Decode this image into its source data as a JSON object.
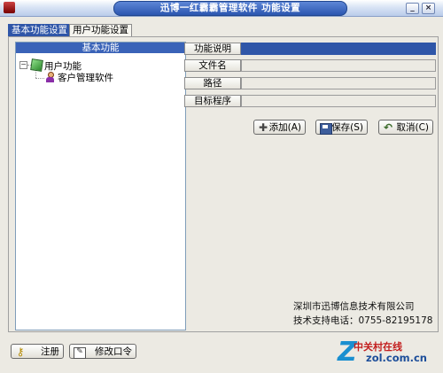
{
  "window": {
    "title": "迅博一红霸霸管理软件   功能设置",
    "minimize_label": "_",
    "close_label": "×"
  },
  "tabs": [
    {
      "label": "基本功能设置",
      "active": true
    },
    {
      "label": "用户功能设置",
      "active": false
    }
  ],
  "tree": {
    "header": "基本功能",
    "expander": "−",
    "root": {
      "label": "用户功能",
      "icon": "green-cube-icon"
    },
    "children": [
      {
        "label": "客户管理软件",
        "icon": "person-icon"
      }
    ]
  },
  "form": {
    "fields": [
      {
        "label": "功能说明",
        "value": ""
      },
      {
        "label": "文件名",
        "value": ""
      },
      {
        "label": "路径",
        "value": ""
      },
      {
        "label": "目标程序",
        "value": ""
      }
    ]
  },
  "buttons": {
    "add": "添加(A)",
    "save": "保存(S)",
    "cancel": "取消(C)",
    "register": "注册",
    "change_password": "修改口令"
  },
  "company": {
    "name": "深圳市迅博信息技术有限公司",
    "support": "技术支持电话：0755-82195178"
  },
  "watermark": {
    "cn": "中关村在线",
    "en": "zol.com.cn"
  },
  "colors": {
    "accent": "#2f56a8",
    "titlebar_pill": "#2b56b0",
    "window_bg": "#eceae3"
  }
}
